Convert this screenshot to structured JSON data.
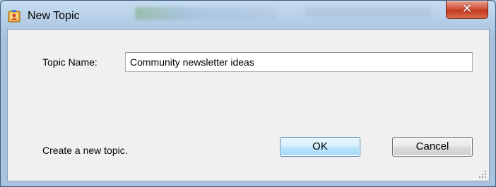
{
  "window": {
    "title": "New Topic",
    "icon": "address-book-icon",
    "close_label": "✕"
  },
  "form": {
    "topic_label": "Topic Name:",
    "topic_value": "Community newsletter ideas",
    "status_text": "Create a new topic."
  },
  "buttons": {
    "ok_label": "OK",
    "cancel_label": "Cancel"
  },
  "colors": {
    "frame": "#a9c3dc",
    "client_bg": "#f0f0f0",
    "default_button_border": "#3c7fb1",
    "close_button": "#c23a1f"
  }
}
